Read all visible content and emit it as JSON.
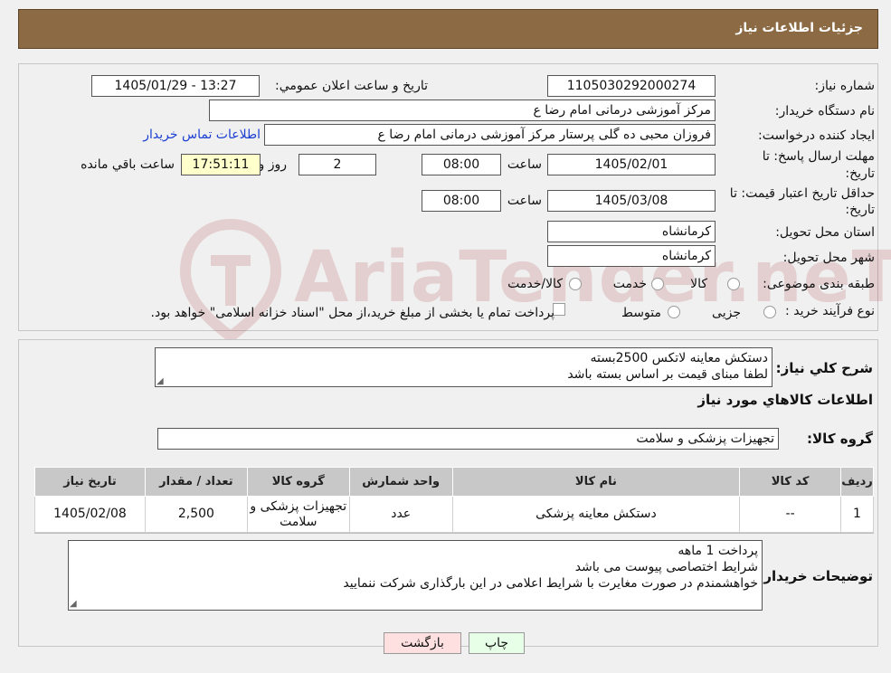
{
  "header": {
    "title": "جزئیات اطلاعات نیاز"
  },
  "form": {
    "need_number_label": "شماره نیاز:",
    "need_number": "1105030292000274",
    "announce_label": "تاریخ و ساعت اعلان عمومي:",
    "announce_value": "1405/01/29 - 13:27",
    "buyer_org_label": "نام دستگاه خریدار:",
    "buyer_org": "مرکز آموزشی  درمانی امام رضا  ع",
    "creator_label": "ایجاد کننده درخواست:",
    "creator": "فروزان محبی ده گلی پرستار مرکز آموزشی  درمانی امام رضا  ع",
    "contact_link": "اطلاعات تماس خريدار",
    "deadline_label_1": "مهلت ارسال پاسخ: تا",
    "deadline_label_2": "تاریخ:",
    "deadline_date": "1405/02/01",
    "time_label": "ساعت",
    "deadline_time": "08:00",
    "days_value": "2",
    "days_label": "روز و",
    "remaining_time": "17:51:11",
    "remaining_label": "ساعت باقي مانده",
    "validity_label_1": "حداقل تاریخ اعتبار قیمت: تا",
    "validity_label_2": "تاریخ:",
    "validity_date": "1405/03/08",
    "validity_time": "08:00",
    "province_label": "استان محل تحویل:",
    "province": "کرمانشاه",
    "city_label": "شهر محل تحویل:",
    "city": "کرمانشاه",
    "category_label": "طبقه بندی موضوعی:",
    "category_options": [
      "کالا",
      "خدمت",
      "کالا/خدمت"
    ],
    "process_label": "نوع فرآیند خرید :",
    "process_options": [
      "جزیی",
      "متوسط"
    ],
    "process_note": "پرداخت تمام یا بخشی از مبلغ خرید،از محل \"اسناد خزانه اسلامی\" خواهد بود."
  },
  "summary": {
    "label": "شرح کلي نياز:",
    "line1": "دستکش معاینه لاتکس     2500بسته",
    "line2": "لطفا مبنای قیمت بر اساس بسته باشد",
    "goods_title": "اطلاعات کالاهاي مورد نياز",
    "group_label": "گروه کالا:",
    "group_value": "تجهیزات پزشکی و سلامت"
  },
  "table": {
    "headers": [
      "ردیف",
      "کد کالا",
      "نام کالا",
      "واحد شمارش",
      "گروه کالا",
      "تعداد / مقدار",
      "تاریخ نیاز"
    ],
    "rows": [
      [
        "1",
        "--",
        "دستکش معاینه پزشکی",
        "عدد",
        "تجهیزات پزشکی و سلامت",
        "2,500",
        "1405/02/08"
      ]
    ]
  },
  "buyer_notes": {
    "label": "توضیحات خریدار:",
    "line1": "پرداخت 1 ماهه",
    "line2": "شرایط اختصاصی پیوست می باشد",
    "line3": "خواهشمندم  در صورت مغایرت با شرایط اعلامی در این بارگذاری شرکت ننمایید"
  },
  "buttons": {
    "print": "چاپ",
    "back": "بازگشت"
  },
  "watermark": {
    "text": "AriaTender.neT"
  },
  "colors": {
    "header_bg": "#8b6a44",
    "link": "#1b3fd1",
    "print_bg": "#e6ffe6",
    "back_bg": "#ffe0e0",
    "watermark": "#a6282b"
  }
}
